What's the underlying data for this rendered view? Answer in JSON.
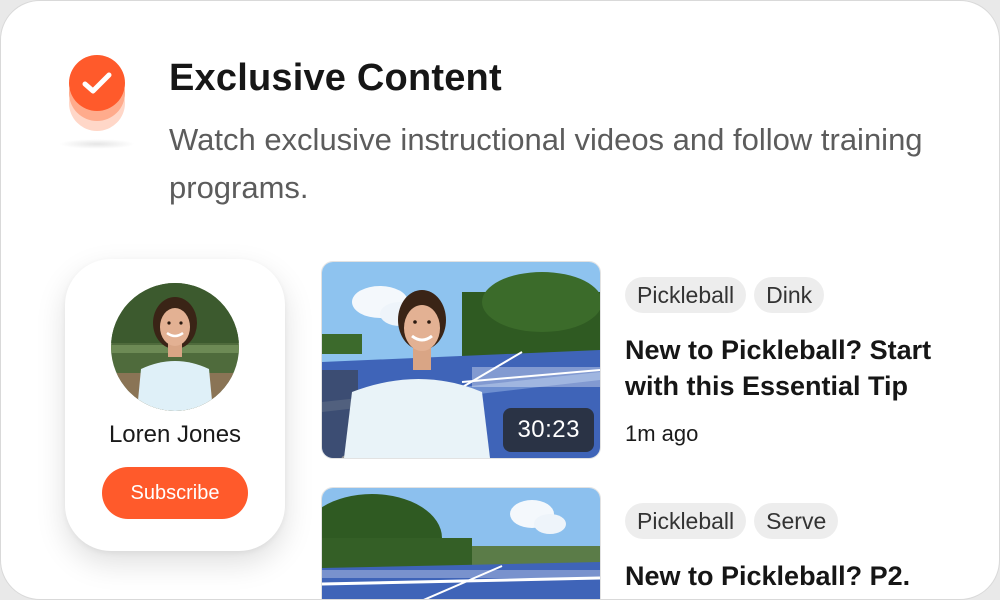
{
  "header": {
    "title": "Exclusive Content",
    "subtitle": "Watch exclusive instructional videos and follow training programs.",
    "badge_icon": "check-icon"
  },
  "creator": {
    "name": "Loren Jones",
    "subscribe_label": "Subscribe"
  },
  "videos": [
    {
      "tags": [
        "Pickleball",
        "Dink"
      ],
      "title": "New to Pickleball? Start with this Essential Tip",
      "duration": "30:23",
      "posted": "1m ago"
    },
    {
      "tags": [
        "Pickleball",
        "Serve"
      ],
      "title": "New to Pickleball? P2."
    }
  ],
  "colors": {
    "accent": "#ff5a2b",
    "court": "#3f64b8",
    "tag_bg": "#ededed"
  }
}
